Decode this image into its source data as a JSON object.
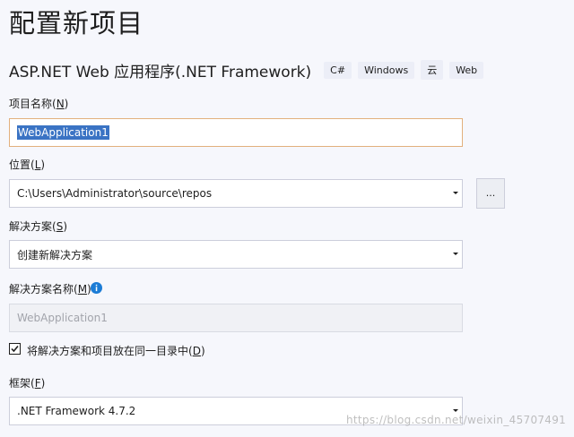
{
  "page": {
    "title": "配置新项目"
  },
  "template": {
    "name": "ASP.NET Web 应用程序(.NET Framework)",
    "tags": [
      "C#",
      "Windows",
      "云",
      "Web"
    ]
  },
  "project_name": {
    "label": "项目名称(",
    "mnemonic": "N",
    "label_end": ")",
    "value": "WebApplication1"
  },
  "location": {
    "label": "位置(",
    "mnemonic": "L",
    "label_end": ")",
    "value": "C:\\Users\\Administrator\\source\\repos",
    "browse_label": "..."
  },
  "solution": {
    "label": "解决方案(",
    "mnemonic": "S",
    "label_end": ")",
    "value": "创建新解决方案"
  },
  "solution_name": {
    "label": "解决方案名称(",
    "mnemonic": "M",
    "label_end": ")",
    "placeholder": "WebApplication1",
    "info_icon": "info-icon"
  },
  "same_directory": {
    "checked": true,
    "label": "将解决方案和项目放在同一目录中(",
    "mnemonic": "D",
    "label_end": ")"
  },
  "framework": {
    "label": "框架(",
    "mnemonic": "F",
    "label_end": ")",
    "value": ".NET Framework 4.7.2"
  },
  "watermark": {
    "text": "https://blog.csdn.net/weixin_45707491"
  },
  "colors": {
    "background": "#f6f7fc",
    "selection": "#3a73c4",
    "focus_border": "#e2b07d",
    "info": "#1c7cd6"
  }
}
